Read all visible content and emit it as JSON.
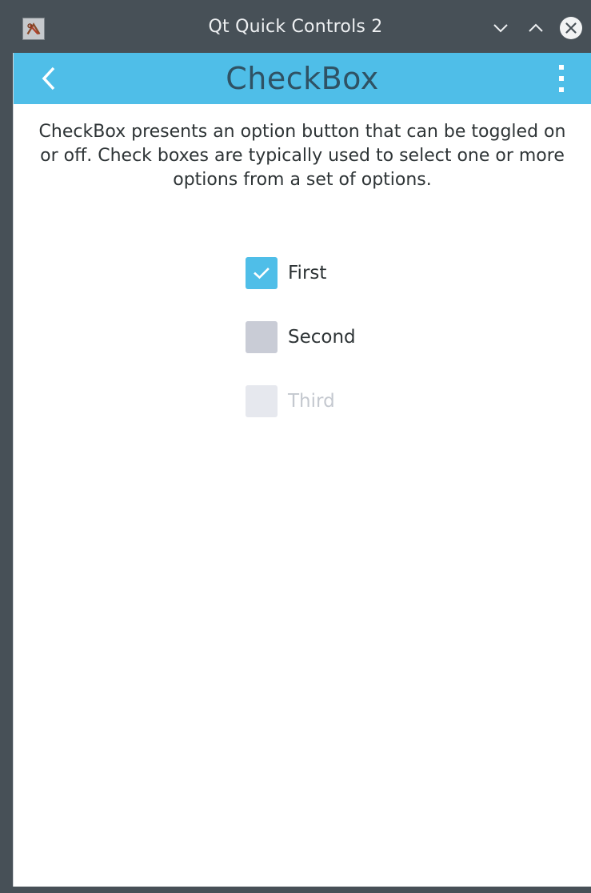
{
  "window": {
    "title": "Qt Quick Controls 2",
    "controls": {
      "minimize_icon": "chevron-down-icon",
      "maximize_icon": "chevron-up-icon",
      "close_icon": "close-icon"
    }
  },
  "toolbar": {
    "title": "CheckBox",
    "back_icon": "back-arrow-icon",
    "menu_icon": "more-vertical-icon",
    "color": "#4fbee8"
  },
  "page": {
    "description": "CheckBox presents an option button that can be toggled on or off. Check boxes are typically used to select one or more options from a set of options."
  },
  "checkboxes": [
    {
      "label": "First",
      "checked": true,
      "enabled": true
    },
    {
      "label": "Second",
      "checked": false,
      "enabled": true
    },
    {
      "label": "Third",
      "checked": false,
      "enabled": false
    }
  ]
}
